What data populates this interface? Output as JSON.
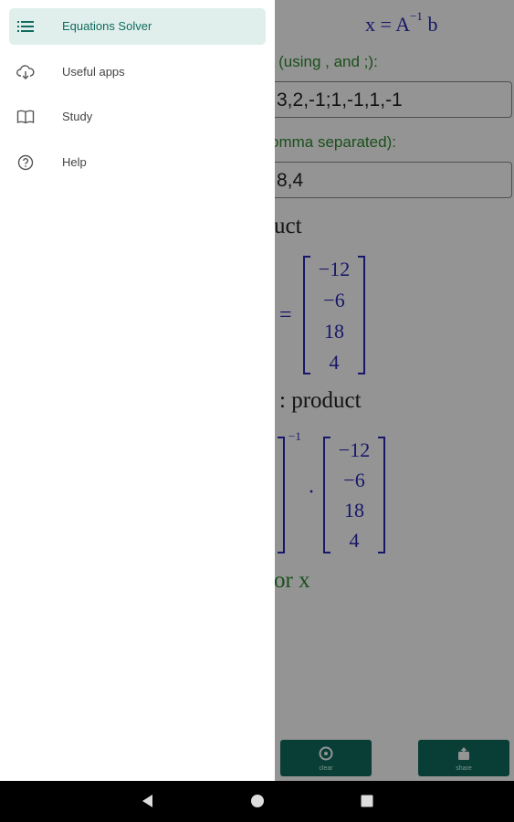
{
  "app": {
    "formula": {
      "lhs": "x = A",
      "exp": "−1",
      "rhs": " b"
    },
    "matrix_label": "A (using , and ;):",
    "matrix_input": "3,2,-1;1,-1,1,-1",
    "vector_label": "omma separated):",
    "vector_input": "8,4",
    "heading1": "uct",
    "heading2": ": product",
    "heading3": "or x",
    "b_vector": [
      "−12",
      "−6",
      "18",
      "4"
    ],
    "inv_exp": "−1",
    "equals": "=",
    "dot": "·",
    "bottom_buttons": [
      {
        "icon": "clear-icon",
        "label": "clear"
      },
      {
        "icon": "share-icon",
        "label": "share"
      }
    ]
  },
  "drawer": {
    "items": [
      {
        "label": "Equations Solver",
        "icon": "list-icon",
        "active": true
      },
      {
        "label": "Useful apps",
        "icon": "cloud-download-icon",
        "active": false
      },
      {
        "label": "Study",
        "icon": "book-icon",
        "active": false
      },
      {
        "label": "Help",
        "icon": "help-icon",
        "active": false
      }
    ]
  },
  "system_nav": [
    "back-icon",
    "home-icon",
    "recents-icon"
  ],
  "colors": {
    "accent": "#0f6b5e",
    "active_bg": "#e0efec",
    "math": "#2a2ab8",
    "label_green": "#2e8b2e"
  }
}
